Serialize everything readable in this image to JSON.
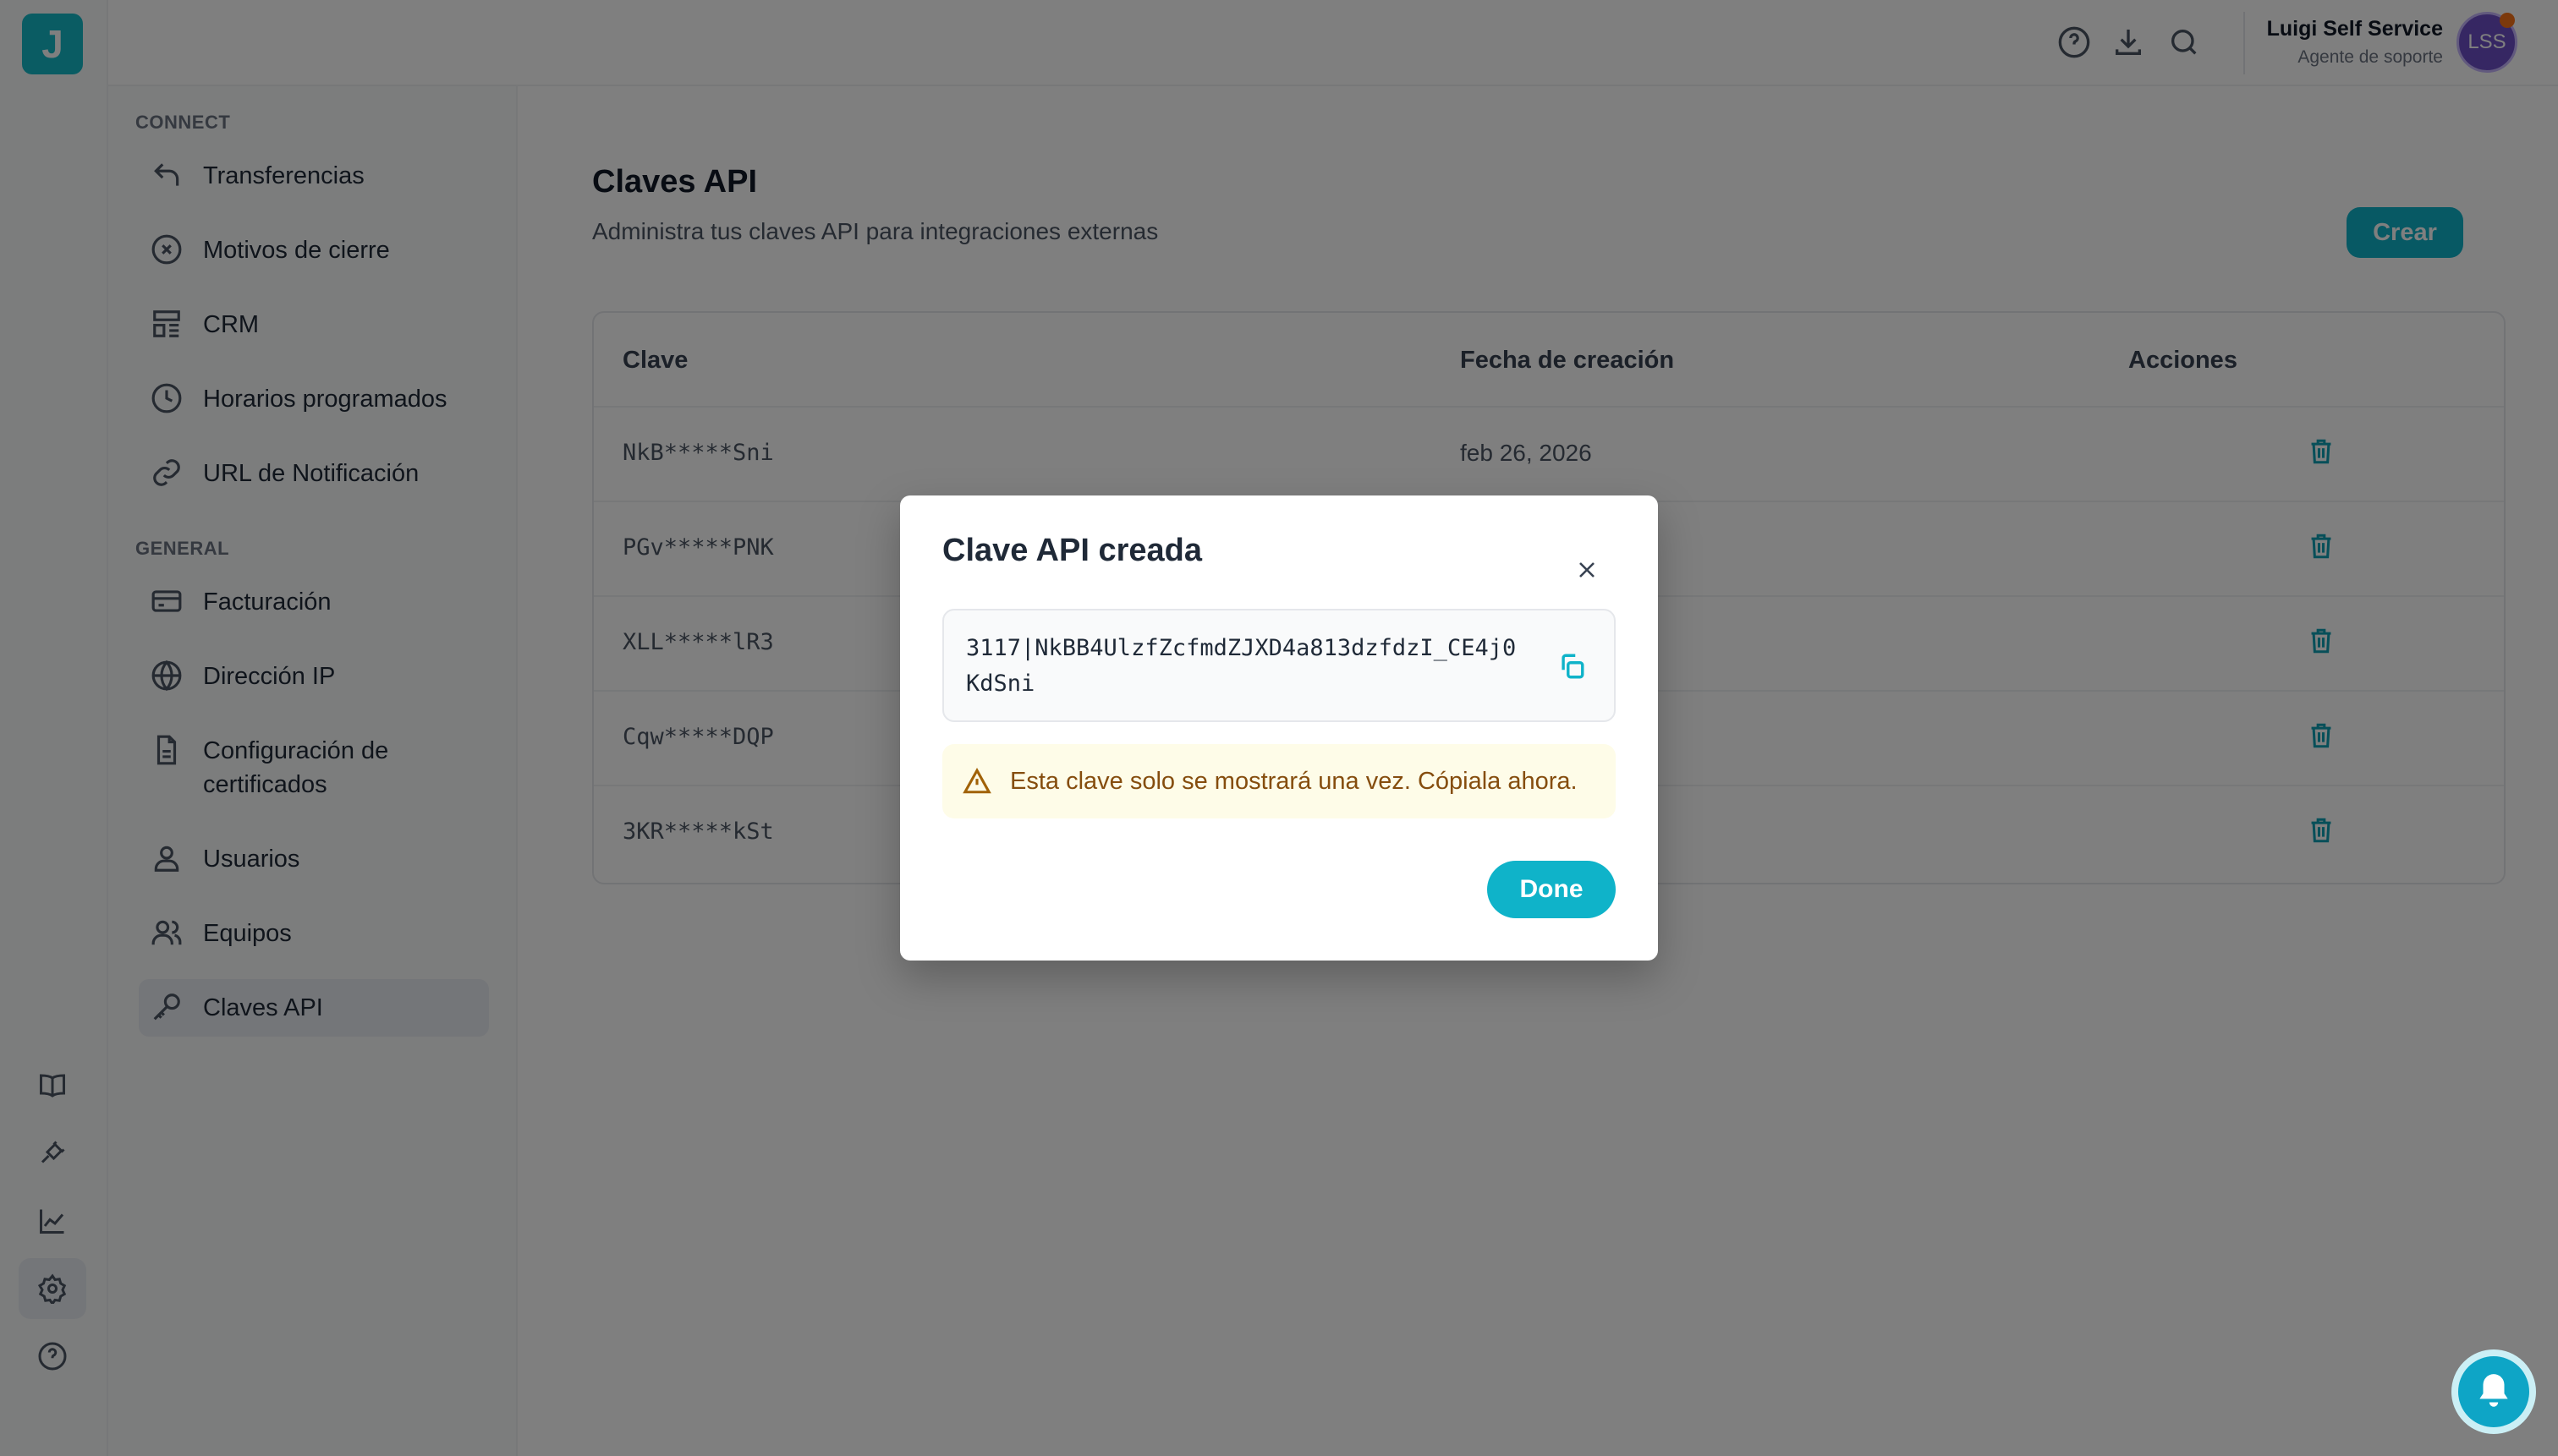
{
  "header": {
    "user_name": "Luigi Self Service",
    "user_role": "Agente de soporte",
    "avatar_initials": "LSS",
    "icons": [
      "help-icon",
      "download-icon",
      "search-icon"
    ]
  },
  "rail": {
    "logo_letter": "J",
    "icons": [
      "book-icon",
      "plug-icon",
      "chart-icon",
      "gear-icon",
      "help-icon"
    ]
  },
  "sidebar": {
    "section_connect": "CONNECT",
    "connect_items": [
      {
        "label": "Transferencias",
        "icon": "transfer-icon"
      },
      {
        "label": "Motivos de cierre",
        "icon": "close-circle-icon"
      },
      {
        "label": "CRM",
        "icon": "crm-icon"
      },
      {
        "label": "Horarios programados",
        "icon": "clock-icon"
      },
      {
        "label": "URL de Notificación",
        "icon": "link-icon"
      }
    ],
    "section_general": "GENERAL",
    "general_items": [
      {
        "label": "Facturación",
        "icon": "credit-card-icon"
      },
      {
        "label": "Dirección IP",
        "icon": "globe-icon"
      },
      {
        "label": "Configuración de certificados",
        "icon": "document-icon"
      },
      {
        "label": "Usuarios",
        "icon": "user-icon"
      },
      {
        "label": "Equipos",
        "icon": "users-icon"
      },
      {
        "label": "Claves API",
        "icon": "key-icon",
        "active": true
      }
    ]
  },
  "main": {
    "title": "Claves API",
    "subtitle": "Administra tus claves API para integraciones externas",
    "create_label": "Crear",
    "table": {
      "headers": [
        "Clave",
        "Fecha de creación",
        "Acciones"
      ],
      "rows": [
        {
          "key": "NkB*****Sni",
          "date": "feb 26, 2026"
        },
        {
          "key": "PGv*****PNK",
          "date": ""
        },
        {
          "key": "XLL*****lR3",
          "date": ""
        },
        {
          "key": "Cqw*****DQP",
          "date": ""
        },
        {
          "key": "3KR*****kSt",
          "date": ""
        }
      ]
    }
  },
  "modal": {
    "title": "Clave API creada",
    "key_value": "3117|NkBB4UlzfZcfmdZJXD4a813dzfdzI_CE4j0KdSni",
    "warning": "Esta clave solo se mostrará una vez. Cópiala ahora.",
    "done_label": "Done"
  },
  "colors": {
    "accent": "#0fb3c9",
    "warning_bg": "#fefce8",
    "warning_text": "#854d0e",
    "avatar": "#6d4fc7"
  }
}
